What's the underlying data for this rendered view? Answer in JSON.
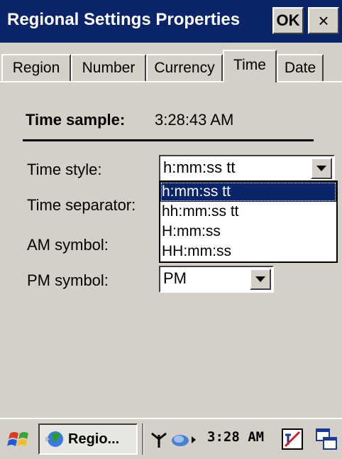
{
  "window": {
    "title": "Regional Settings Properties",
    "ok_label": "OK",
    "close_label": "×"
  },
  "tabs": [
    {
      "label": "Region"
    },
    {
      "label": "Number"
    },
    {
      "label": "Currency"
    },
    {
      "label": "Time",
      "active": true
    },
    {
      "label": "Date"
    }
  ],
  "time_sample": {
    "label": "Time sample:",
    "value": "3:28:43 AM"
  },
  "fields": {
    "time_style": {
      "label": "Time style:",
      "value": "h:mm:ss tt"
    },
    "time_separator": {
      "label": "Time separator:"
    },
    "am_symbol": {
      "label": "AM symbol:"
    },
    "pm_symbol": {
      "label": "PM symbol:",
      "value": "PM"
    }
  },
  "dropdown": {
    "options": [
      "h:mm:ss tt",
      "hh:mm:ss tt",
      "H:mm:ss",
      "HH:mm:ss"
    ],
    "selected_index": 0
  },
  "taskbar": {
    "task_label": "Regio...",
    "clock": "3:28 AM"
  },
  "colors": {
    "titlebar": "#0a246a",
    "face": "#d4d0c8",
    "selection": "#0a246a"
  }
}
